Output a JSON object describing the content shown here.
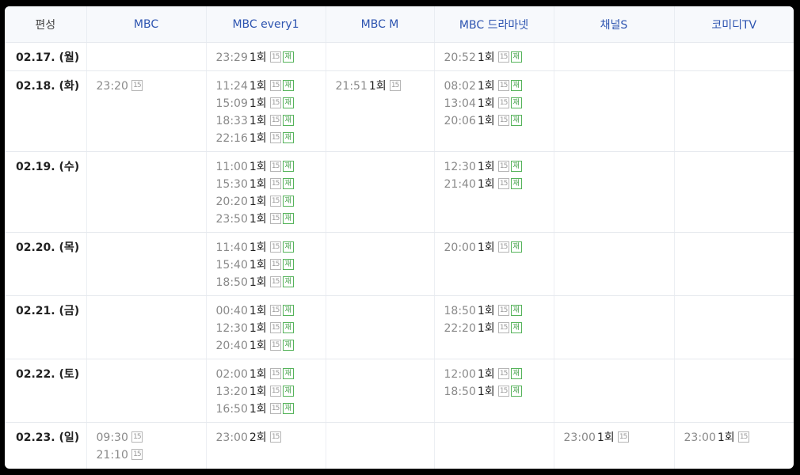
{
  "header": {
    "corner_label": "편성",
    "channels": [
      "MBC",
      "MBC every1",
      "MBC M",
      "MBC 드라마넷",
      "채널S",
      "코미디TV"
    ]
  },
  "badges": {
    "age": "15",
    "rerun": "재"
  },
  "rows": [
    {
      "date": "02.17. (월)",
      "cells": [
        [],
        [
          {
            "time": "23:29",
            "ep": "1회",
            "rerun": true
          }
        ],
        [],
        [
          {
            "time": "20:52",
            "ep": "1회",
            "rerun": true
          }
        ],
        [],
        []
      ]
    },
    {
      "date": "02.18. (화)",
      "cells": [
        [
          {
            "time": "23:20",
            "ep": "",
            "rerun": false
          }
        ],
        [
          {
            "time": "11:24",
            "ep": "1회",
            "rerun": true
          },
          {
            "time": "15:09",
            "ep": "1회",
            "rerun": true
          },
          {
            "time": "18:33",
            "ep": "1회",
            "rerun": true
          },
          {
            "time": "22:16",
            "ep": "1회",
            "rerun": true
          }
        ],
        [
          {
            "time": "21:51",
            "ep": "1회",
            "rerun": false
          }
        ],
        [
          {
            "time": "08:02",
            "ep": "1회",
            "rerun": true
          },
          {
            "time": "13:04",
            "ep": "1회",
            "rerun": true
          },
          {
            "time": "20:06",
            "ep": "1회",
            "rerun": true
          }
        ],
        [],
        []
      ]
    },
    {
      "date": "02.19. (수)",
      "cells": [
        [],
        [
          {
            "time": "11:00",
            "ep": "1회",
            "rerun": true
          },
          {
            "time": "15:30",
            "ep": "1회",
            "rerun": true
          },
          {
            "time": "20:20",
            "ep": "1회",
            "rerun": true
          },
          {
            "time": "23:50",
            "ep": "1회",
            "rerun": true
          }
        ],
        [],
        [
          {
            "time": "12:30",
            "ep": "1회",
            "rerun": true
          },
          {
            "time": "21:40",
            "ep": "1회",
            "rerun": true
          }
        ],
        [],
        []
      ]
    },
    {
      "date": "02.20. (목)",
      "cells": [
        [],
        [
          {
            "time": "11:40",
            "ep": "1회",
            "rerun": true
          },
          {
            "time": "15:40",
            "ep": "1회",
            "rerun": true
          },
          {
            "time": "18:50",
            "ep": "1회",
            "rerun": true
          }
        ],
        [],
        [
          {
            "time": "20:00",
            "ep": "1회",
            "rerun": true
          }
        ],
        [],
        []
      ]
    },
    {
      "date": "02.21. (금)",
      "cells": [
        [],
        [
          {
            "time": "00:40",
            "ep": "1회",
            "rerun": true
          },
          {
            "time": "12:30",
            "ep": "1회",
            "rerun": true
          },
          {
            "time": "20:40",
            "ep": "1회",
            "rerun": true
          }
        ],
        [],
        [
          {
            "time": "18:50",
            "ep": "1회",
            "rerun": true
          },
          {
            "time": "22:20",
            "ep": "1회",
            "rerun": true
          }
        ],
        [],
        []
      ]
    },
    {
      "date": "02.22. (토)",
      "cells": [
        [],
        [
          {
            "time": "02:00",
            "ep": "1회",
            "rerun": true
          },
          {
            "time": "13:20",
            "ep": "1회",
            "rerun": true
          },
          {
            "time": "16:50",
            "ep": "1회",
            "rerun": true
          }
        ],
        [],
        [
          {
            "time": "12:00",
            "ep": "1회",
            "rerun": true
          },
          {
            "time": "18:50",
            "ep": "1회",
            "rerun": true
          }
        ],
        [],
        []
      ]
    },
    {
      "date": "02.23. (일)",
      "cells": [
        [
          {
            "time": "09:30",
            "ep": "",
            "rerun": false
          },
          {
            "time": "21:10",
            "ep": "",
            "rerun": false
          }
        ],
        [
          {
            "time": "23:00",
            "ep": "2회",
            "rerun": false
          }
        ],
        [],
        [],
        [
          {
            "time": "23:00",
            "ep": "1회",
            "rerun": false
          }
        ],
        [
          {
            "time": "23:00",
            "ep": "1회",
            "rerun": false
          }
        ]
      ]
    }
  ],
  "colors": {
    "header_text": "#2d54b0",
    "header_bg": "#f7f9fc",
    "time_text": "#8a8a8a",
    "rerun_badge": "#55b35a",
    "age_badge": "#b5b5b5"
  }
}
